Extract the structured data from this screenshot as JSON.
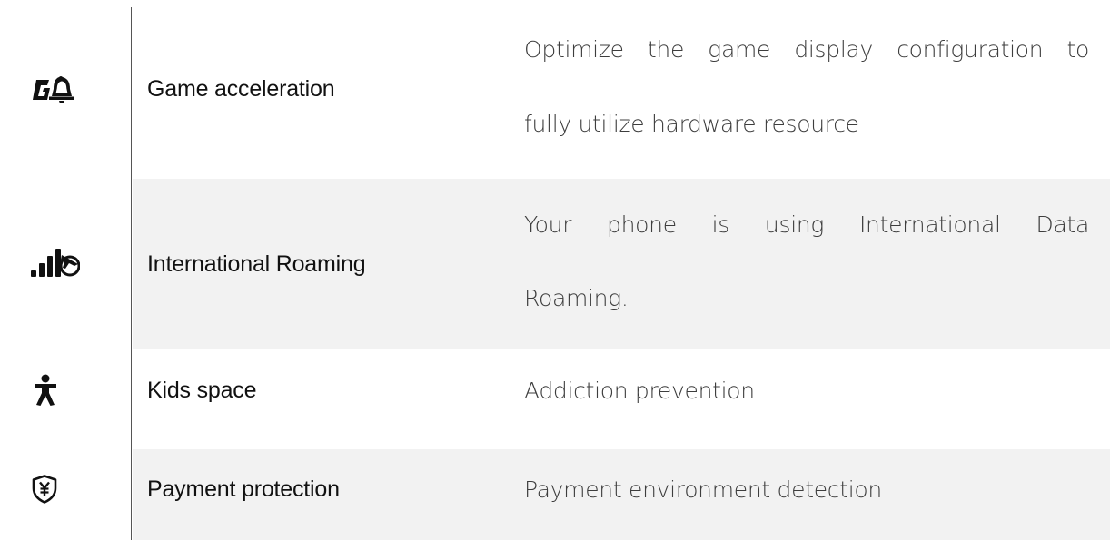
{
  "rows": [
    {
      "icon": "game-acceleration-icon",
      "name": "Game acceleration",
      "description_lines": [
        "Optimize the game display configuration to",
        "fully utilize hardware resource"
      ]
    },
    {
      "icon": "international-roaming-icon",
      "name": "International Roaming",
      "description_lines": [
        "Your phone is using International Data",
        "Roaming."
      ]
    },
    {
      "icon": "kids-space-icon",
      "name": "Kids space",
      "description": "Addiction prevention"
    },
    {
      "icon": "payment-protection-icon",
      "name": "Payment protection",
      "description": "Payment environment detection"
    }
  ],
  "colors": {
    "shaded_row": "#f2f2f2",
    "divider": "#555555",
    "name_text": "#111111",
    "description_text": "#3d3d3d"
  }
}
